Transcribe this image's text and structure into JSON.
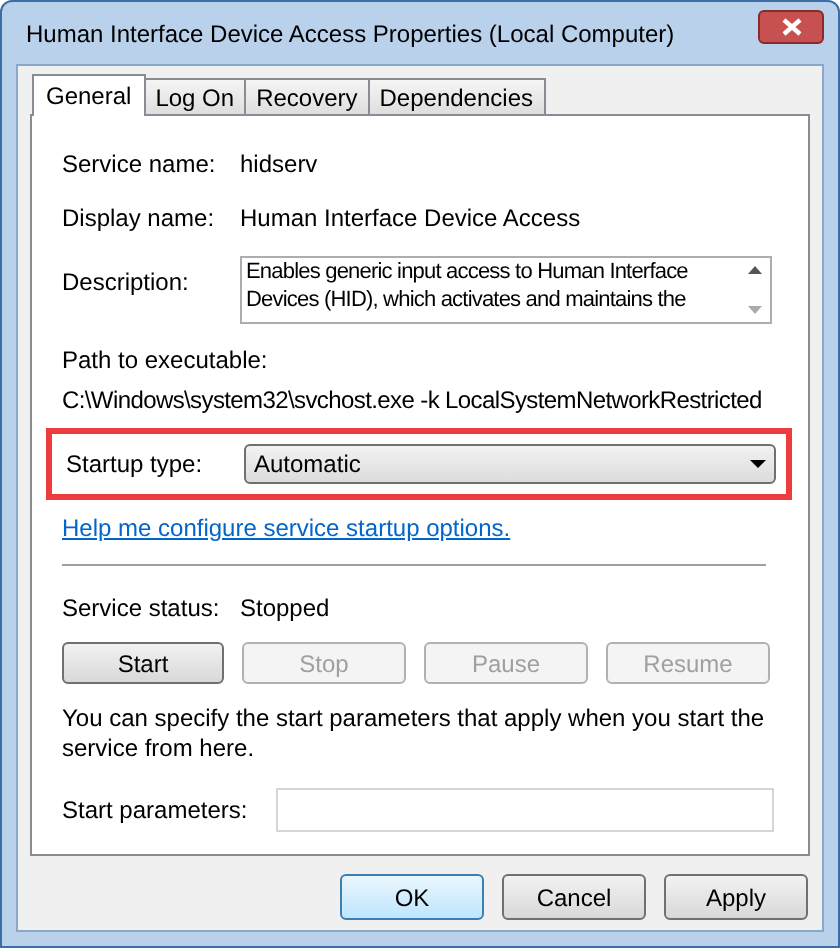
{
  "window": {
    "title": "Human Interface Device Access Properties (Local Computer)"
  },
  "tabs": [
    {
      "label": "General",
      "selected": true
    },
    {
      "label": "Log On",
      "selected": false
    },
    {
      "label": "Recovery",
      "selected": false
    },
    {
      "label": "Dependencies",
      "selected": false
    }
  ],
  "fields": [
    {
      "label": "Service name:",
      "value": "hidserv"
    },
    {
      "label": "Display name:",
      "value": "Human Interface Device Access"
    }
  ],
  "description": {
    "label": "Description:",
    "value": "Enables generic input access to Human Interface Devices (HID), which activates and maintains the"
  },
  "path": {
    "label": "Path to executable:",
    "value": "C:\\Windows\\system32\\svchost.exe -k LocalSystemNetworkRestricted"
  },
  "startup_type": {
    "label": "Startup type:",
    "value": "Automatic",
    "highlighted": true
  },
  "help_link": "Help me configure service startup options.",
  "service_status": {
    "label": "Service status:",
    "value": "Stopped"
  },
  "service_buttons": [
    {
      "label": "Start",
      "disabled": false
    },
    {
      "label": "Stop",
      "disabled": true
    },
    {
      "label": "Pause",
      "disabled": true
    },
    {
      "label": "Resume",
      "disabled": true
    }
  ],
  "note": "You can specify the start parameters that apply when you start the service from here.",
  "start_parameters": {
    "label": "Start parameters:"
  },
  "dialog_buttons": [
    {
      "label": "OK",
      "default": true
    },
    {
      "label": "Cancel",
      "default": false
    },
    {
      "label": "Apply",
      "default": false
    }
  ]
}
